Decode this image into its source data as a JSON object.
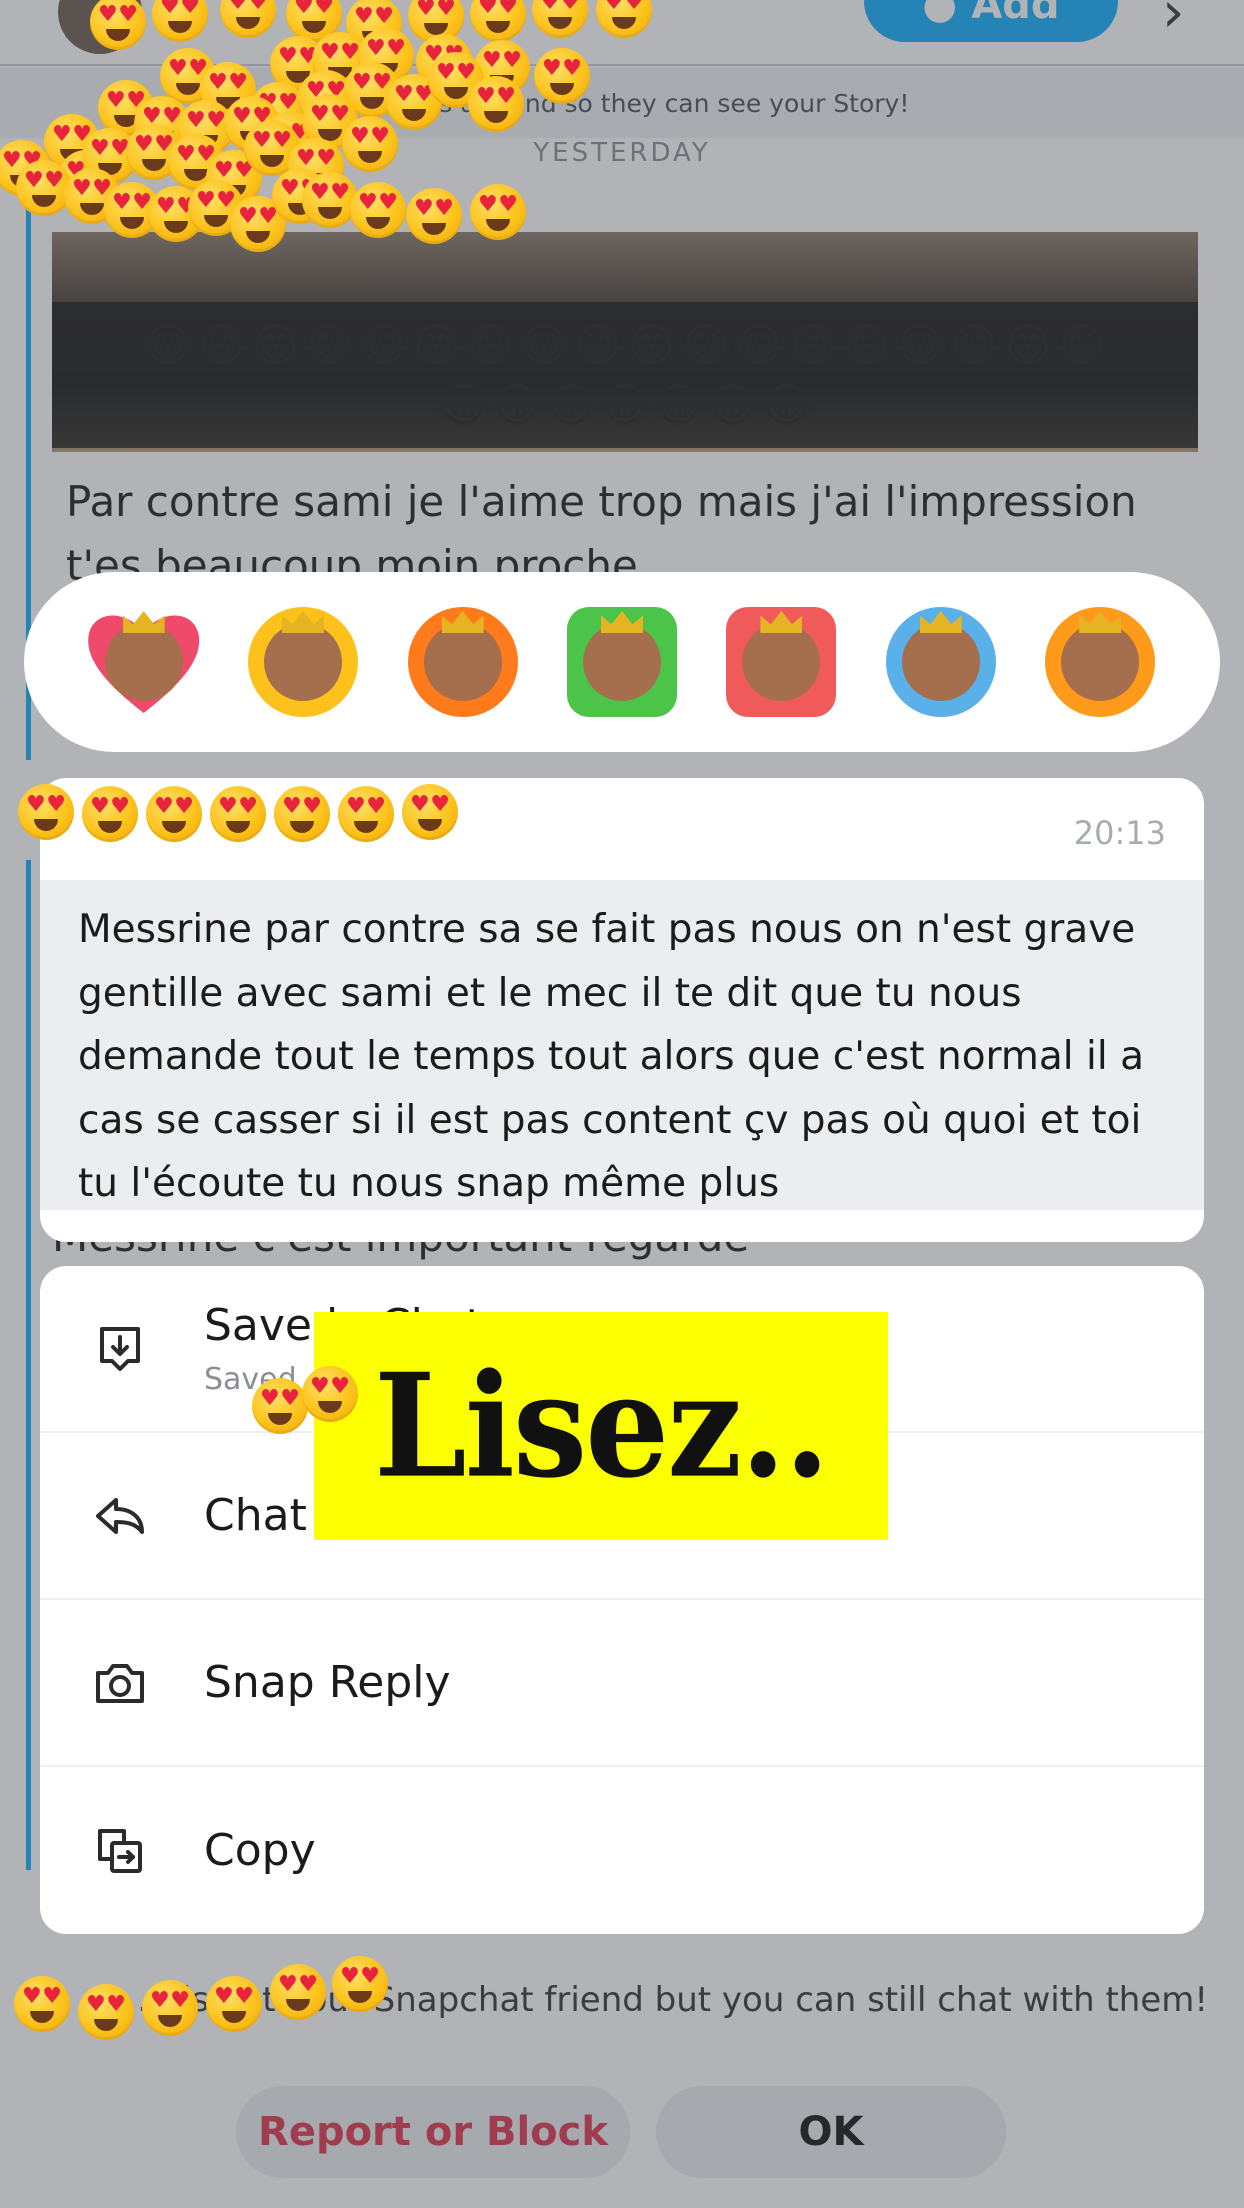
{
  "background_chat": {
    "add_button_label": "Add",
    "banner_text": "Add … as a friend so they can see your Story!",
    "day_label": "YESTERDAY",
    "media_caption_row1": "😂😂😂😂😂😂😂😂😂😂😂😂😂😂😂😂😂😂",
    "media_caption_row2": "😂😂😂😂😂😂😂",
    "previous_message": "Par contre sami je l'aime trop mais j'ai l'impression t'es beaucoup moin proche",
    "next_message": "Messrine c'est important regarde",
    "not_friend_notice": "… is not your Snapchat friend but you can still chat with them!",
    "report_button": "Report or Block",
    "ok_button": "OK"
  },
  "reactions": [
    {
      "name": "heart-reaction",
      "color": "#f04a6a"
    },
    {
      "name": "laughing-reaction",
      "color": "#fcc21b"
    },
    {
      "name": "fire-reaction",
      "color": "#ff7a1a"
    },
    {
      "name": "thumbs-up-reaction",
      "color": "#4cc44a"
    },
    {
      "name": "thumbs-down-reaction",
      "color": "#f05a5a"
    },
    {
      "name": "sad-reaction",
      "color": "#5ab0e8"
    },
    {
      "name": "mind-blown-reaction",
      "color": "#ff9a1a"
    }
  ],
  "selected_message": {
    "time": "20:13",
    "text": "Messrine par contre sa se fait pas nous on n'est grave gentille avec sami et le mec il te dit que tu nous demande tout le temps tout alors que c'est normal il a cas se casser si il est pas content çv pas où quoi et toi tu l'écoute tu nous snap même plus"
  },
  "menu": {
    "save_label": "Save in Chat",
    "save_sub": "Saved",
    "reply_label": "Chat Reply",
    "snap_reply_label": "Snap Reply",
    "copy_label": "Copy"
  },
  "sticker": {
    "text": "Lisez.."
  },
  "colors": {
    "accent_blue": "#0fadff",
    "danger_red": "#e0344d",
    "sticker_yellow": "#fbff00"
  }
}
